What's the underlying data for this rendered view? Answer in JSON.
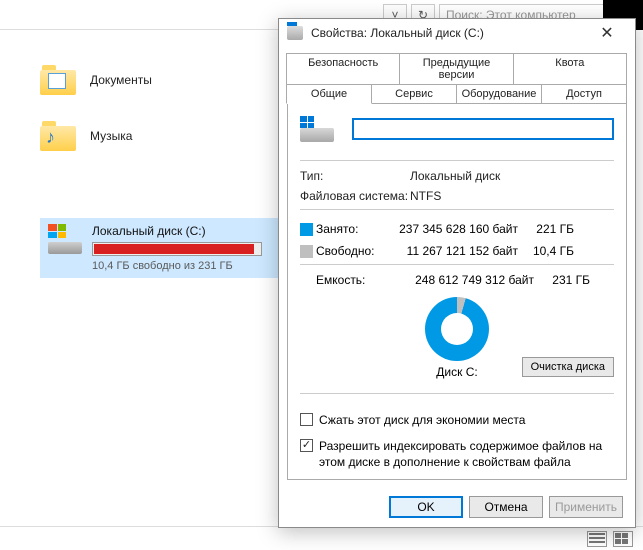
{
  "explorer": {
    "search_placeholder": "Поиск: Этот компьютер",
    "folders": [
      {
        "label": "Документы",
        "glyph": "doc"
      },
      {
        "label": "Музыка",
        "glyph": "note"
      }
    ],
    "drive": {
      "title": "Локальный диск (C:)",
      "subtitle": "10,4 ГБ свободно из 231 ГБ"
    }
  },
  "dialog": {
    "title": "Свойства: Локальный диск (C:)",
    "tabs_row1": [
      "Безопасность",
      "Предыдущие версии",
      "Квота"
    ],
    "tabs_row2": [
      "Общие",
      "Сервис",
      "Оборудование",
      "Доступ"
    ],
    "active_tab": "Общие",
    "name_value": "",
    "type_label": "Тип:",
    "type_value": "Локальный диск",
    "fs_label": "Файловая система:",
    "fs_value": "NTFS",
    "used_label": "Занято:",
    "used_bytes": "237 345 628 160 байт",
    "used_gb": "221 ГБ",
    "free_label": "Свободно:",
    "free_bytes": "11 267 121 152 байт",
    "free_gb": "10,4 ГБ",
    "capacity_label": "Емкость:",
    "capacity_bytes": "248 612 749 312 байт",
    "capacity_gb": "231 ГБ",
    "donut_label": "Диск C:",
    "cleanup_label": "Очистка диска",
    "compress_label": "Сжать этот диск для экономии места",
    "index_label": "Разрешить индексировать содержимое файлов на этом диске в дополнение к свойствам файла",
    "ok_label": "OK",
    "cancel_label": "Отмена",
    "apply_label": "Применить"
  },
  "colors": {
    "used": "#0099e5",
    "free": "#bfbfbf",
    "accent": "#0078d7",
    "danger": "#d92020"
  }
}
